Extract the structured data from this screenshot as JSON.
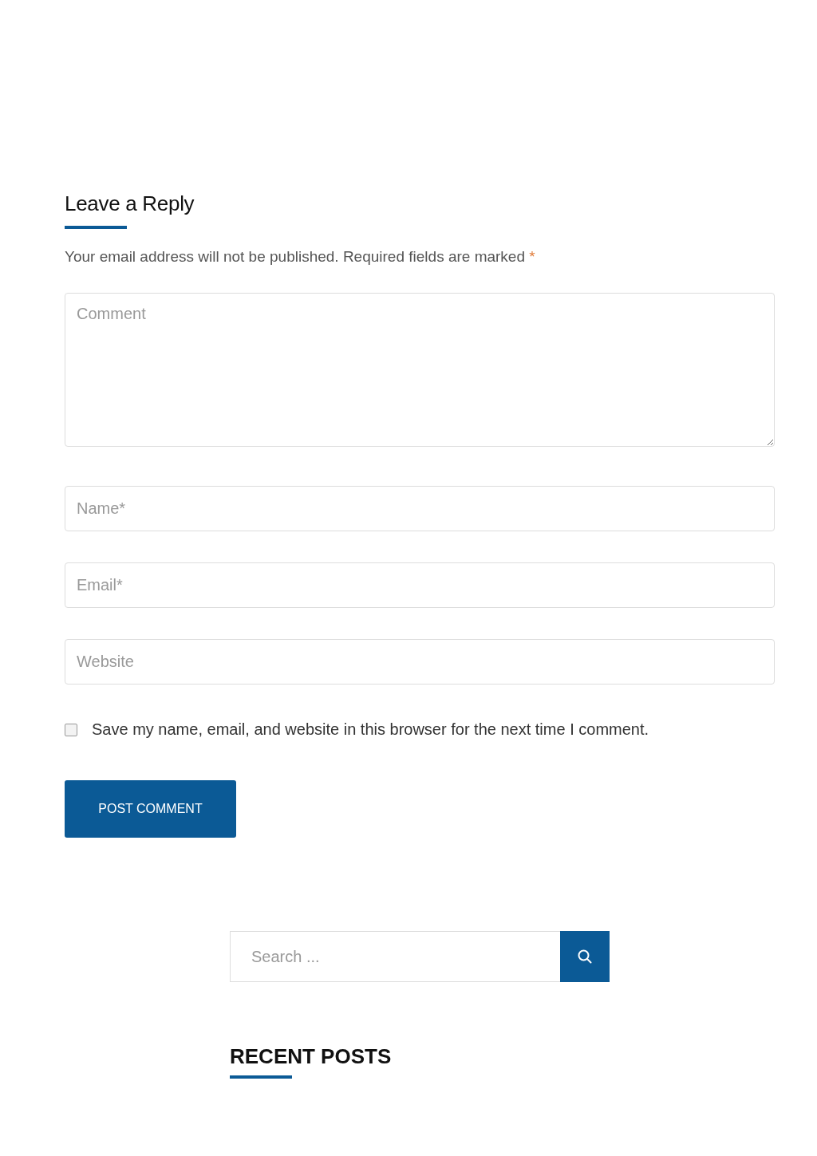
{
  "comment_form": {
    "title": "Leave a Reply",
    "notice": "Your email address will not be published. Required fields are marked",
    "required_mark": "*",
    "fields": [
      {
        "kind": "textarea",
        "placeholder": "Comment"
      },
      {
        "kind": "input",
        "placeholder": "Name*"
      },
      {
        "kind": "input",
        "placeholder": "Email*"
      },
      {
        "kind": "input",
        "placeholder": "Website"
      }
    ],
    "save_checkbox": {
      "label": "Save my name, email, and website in this browser for the next time I comment.",
      "checked": false
    },
    "submit_button": "POST COMMENT"
  },
  "search": {
    "placeholder": "Search ..."
  },
  "recent_posts": {
    "title": "RECENT POSTS"
  }
}
